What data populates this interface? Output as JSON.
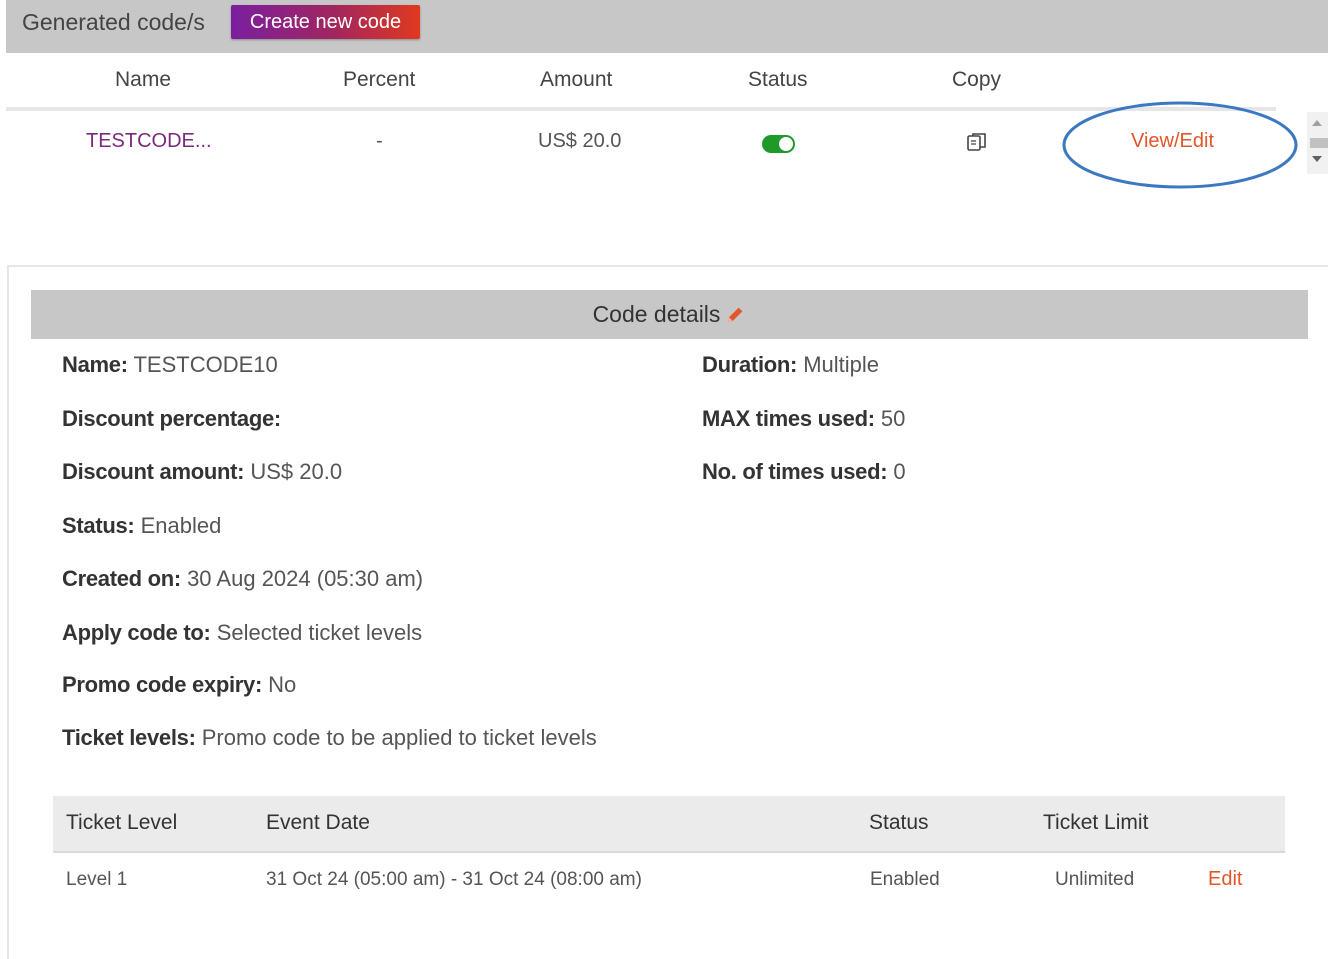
{
  "header": {
    "title": "Generated code/s",
    "create_button": "Create new code"
  },
  "codes_table": {
    "columns": [
      "Name",
      "Percent",
      "Amount",
      "Status",
      "Copy"
    ],
    "rows": [
      {
        "name": "TESTCODE...",
        "percent": "-",
        "amount": "US$ 20.0",
        "status_enabled": true,
        "action": "View/Edit"
      }
    ]
  },
  "colors": {
    "accent": "#e2562a",
    "toggle_on": "#1e9a2b",
    "highlight": "#3b78c2",
    "header_bg": "#c7c7c7"
  },
  "details": {
    "title": "Code details",
    "left": [
      {
        "label": "Name:",
        "value": "TESTCODE10"
      },
      {
        "label": "Discount percentage:",
        "value": ""
      },
      {
        "label": "Discount amount:",
        "value": "US$ 20.0"
      },
      {
        "label": "Status:",
        "value": "Enabled"
      },
      {
        "label": "Created on:",
        "value": "30 Aug 2024 (05:30 am)"
      },
      {
        "label": "Apply code to:",
        "value": "Selected ticket levels"
      },
      {
        "label": "Promo code expiry:",
        "value": "No"
      },
      {
        "label": "Ticket levels:",
        "value": "Promo code to be applied to ticket levels"
      }
    ],
    "right": [
      {
        "label": "Duration:",
        "value": "Multiple"
      },
      {
        "label": "MAX times used:",
        "value": "50"
      },
      {
        "label": "No. of times used:",
        "value": "0"
      }
    ]
  },
  "ticket_table": {
    "columns": [
      "Ticket Level",
      "Event Date",
      "Status",
      "Ticket Limit"
    ],
    "rows": [
      {
        "level": "Level 1",
        "event_date": "31 Oct 24 (05:00 am) - 31 Oct 24 (08:00 am)",
        "status": "Enabled",
        "limit": "Unlimited",
        "action": "Edit"
      }
    ]
  }
}
